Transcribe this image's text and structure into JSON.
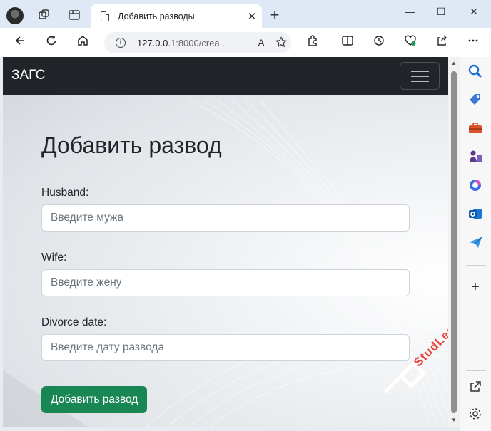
{
  "browser": {
    "tab_title": "Добавить разводы",
    "tab_close": "✕",
    "new_tab": "+",
    "url_host": "127.0.0.1",
    "url_rest": ":8000/crea...",
    "read_aloud": "A",
    "window_minimize": "—",
    "window_maximize": "☐",
    "window_close": "✕"
  },
  "navbar": {
    "brand": "ЗАГС"
  },
  "form": {
    "heading": "Добавить развод",
    "husband_label": "Husband:",
    "husband_placeholder": "Введите мужа",
    "wife_label": "Wife:",
    "wife_placeholder": "Введите жену",
    "date_label": "Divorce date:",
    "date_placeholder": "Введите дату развода",
    "submit_label": "Добавить развод"
  },
  "watermark": {
    "text": "StudLearn"
  },
  "colors": {
    "navbar_bg": "#212529",
    "submit_bg": "#198754",
    "tabbar_bg": "#dfe9f6",
    "watermark": "#e8463c"
  },
  "icons": {
    "edge_sidebar": [
      "search-icon",
      "tag-icon",
      "toolbox-icon",
      "games-icon",
      "copilot-icon",
      "outlook-icon",
      "send-icon",
      "add-icon",
      "open-external-icon",
      "settings-icon"
    ]
  }
}
